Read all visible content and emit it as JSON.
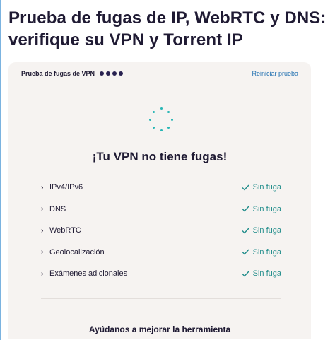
{
  "page": {
    "title": "Prueba de fugas de IP, WebRTC y DNS: verifique su VPN y Torrent IP"
  },
  "card": {
    "header_title": "Prueba de fugas de VPN",
    "progress_dots": 4,
    "restart_label": "Reiniciar prueba",
    "result_heading": "¡Tu VPN no tiene fugas!",
    "checks": [
      {
        "label": "IPv4/IPv6",
        "status": "Sin fuga"
      },
      {
        "label": "DNS",
        "status": "Sin fuga"
      },
      {
        "label": "WebRTC",
        "status": "Sin fuga"
      },
      {
        "label": "Geolocalización",
        "status": "Sin fuga"
      },
      {
        "label": "Exámenes adicionales",
        "status": "Sin fuga"
      }
    ],
    "feedback_heading": "Ayúdanos a mejorar la herramienta"
  },
  "icons": {
    "spinner": "loading-spinner-icon",
    "chevron": "chevron-right-icon",
    "check": "check-icon"
  },
  "colors": {
    "card_background": "#f6f3f1",
    "accent_teal": "#1f8c8a",
    "link_blue": "#1f6fb0",
    "dot_navy": "#282150"
  }
}
